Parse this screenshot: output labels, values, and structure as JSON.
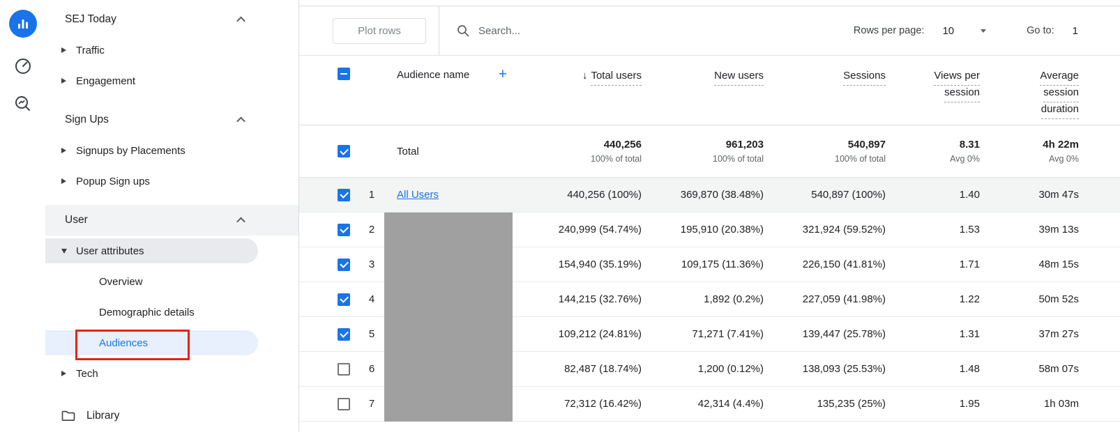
{
  "colors": {
    "accent_blue": "#1a73e8",
    "annotation_red": "#e8220c",
    "redaction_gray": "#a0a0a0",
    "selected_pill_gray": "#e8eaed",
    "selected_pill_blue": "#e8f0fe"
  },
  "icon_rail": {
    "icons": [
      {
        "name": "analytics-bar-chart-icon"
      },
      {
        "name": "speed-gauge-icon"
      },
      {
        "name": "search-insights-icon"
      }
    ]
  },
  "nav": {
    "sections": [
      {
        "label": "SEJ Today",
        "items": [
          "Traffic",
          "Engagement"
        ]
      },
      {
        "label": "Sign Ups",
        "items": [
          "Signups by Placements",
          "Popup Sign ups"
        ]
      },
      {
        "label": "User"
      }
    ],
    "user_attributes": {
      "label": "User attributes",
      "children": [
        "Overview",
        "Demographic details",
        "Audiences"
      ]
    },
    "tech_label": "Tech",
    "library_label": "Library"
  },
  "toolbar": {
    "plot_rows_label": "Plot rows",
    "search_placeholder": "Search...",
    "rows_per_page_label": "Rows per page:",
    "rows_per_page_value": "10",
    "goto_label": "Go to:",
    "goto_value": "1"
  },
  "table": {
    "header": {
      "name_column": "Audience name",
      "add_button": "+",
      "sort_arrow": "↓",
      "columns": [
        "Total users",
        "New users",
        "Sessions",
        "Views per session",
        "Average session duration"
      ]
    },
    "total_row": {
      "label": "Total",
      "metrics": [
        {
          "value": "440,256",
          "sub": "100% of total"
        },
        {
          "value": "961,203",
          "sub": "100% of total"
        },
        {
          "value": "540,897",
          "sub": "100% of total"
        },
        {
          "value": "8.31",
          "sub": "Avg 0%"
        },
        {
          "value": "4h 22m",
          "sub": "Avg 0%"
        }
      ]
    },
    "rows": [
      {
        "index": "1",
        "checked": true,
        "shaded": true,
        "redacted": false,
        "name": "All Users",
        "metrics": [
          "440,256 (100%)",
          "369,870 (38.48%)",
          "540,897 (100%)",
          "1.40",
          "30m 47s"
        ]
      },
      {
        "index": "2",
        "checked": true,
        "shaded": false,
        "redacted": true,
        "metrics": [
          "240,999 (54.74%)",
          "195,910 (20.38%)",
          "321,924 (59.52%)",
          "1.53",
          "39m 13s"
        ]
      },
      {
        "index": "3",
        "checked": true,
        "shaded": false,
        "redacted": true,
        "metrics": [
          "154,940 (35.19%)",
          "109,175 (11.36%)",
          "226,150 (41.81%)",
          "1.71",
          "48m 15s"
        ]
      },
      {
        "index": "4",
        "checked": true,
        "shaded": false,
        "redacted": true,
        "metrics": [
          "144,215 (32.76%)",
          "1,892 (0.2%)",
          "227,059 (41.98%)",
          "1.22",
          "50m 52s"
        ]
      },
      {
        "index": "5",
        "checked": true,
        "shaded": false,
        "redacted": true,
        "metrics": [
          "109,212 (24.81%)",
          "71,271 (7.41%)",
          "139,447 (25.78%)",
          "1.31",
          "37m 27s"
        ]
      },
      {
        "index": "6",
        "checked": false,
        "shaded": false,
        "redacted": true,
        "metrics": [
          "82,487 (18.74%)",
          "1,200 (0.12%)",
          "138,093 (25.53%)",
          "1.48",
          "58m 07s"
        ]
      },
      {
        "index": "7",
        "checked": false,
        "shaded": false,
        "redacted": true,
        "metrics": [
          "72,312 (16.42%)",
          "42,314 (4.4%)",
          "135,235 (25%)",
          "1.95",
          "1h 03m"
        ]
      }
    ]
  }
}
